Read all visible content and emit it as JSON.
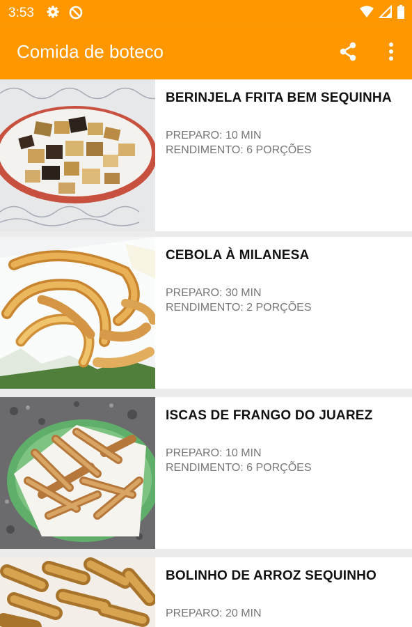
{
  "status": {
    "time": "3:53"
  },
  "toolbar": {
    "title": "Comida de boteco"
  },
  "recipes": [
    {
      "title": "BERINJELA FRITA BEM SEQUINHA",
      "prep": "PREPARO: 10 MIN",
      "yield": "RENDIMENTO: 6 PORÇÕES"
    },
    {
      "title": "CEBOLA À MILANESA",
      "prep": "PREPARO: 30 MIN",
      "yield": "RENDIMENTO: 2 PORÇÕES"
    },
    {
      "title": "ISCAS DE FRANGO DO JUAREZ",
      "prep": "PREPARO: 10 MIN",
      "yield": "RENDIMENTO: 6 PORÇÕES"
    },
    {
      "title": "BOLINHO DE ARROZ SEQUINHO",
      "prep": "PREPARO: 20 MIN",
      "yield": ""
    }
  ],
  "icons": {
    "status": [
      "settings-icon",
      "sync-disabled-icon",
      "wifi-icon",
      "cell-signal-icon",
      "battery-icon"
    ],
    "toolbar": [
      "share-icon",
      "more-vert-icon"
    ]
  },
  "colors": {
    "primary": "#FE9700",
    "background": "#ECECEC"
  }
}
